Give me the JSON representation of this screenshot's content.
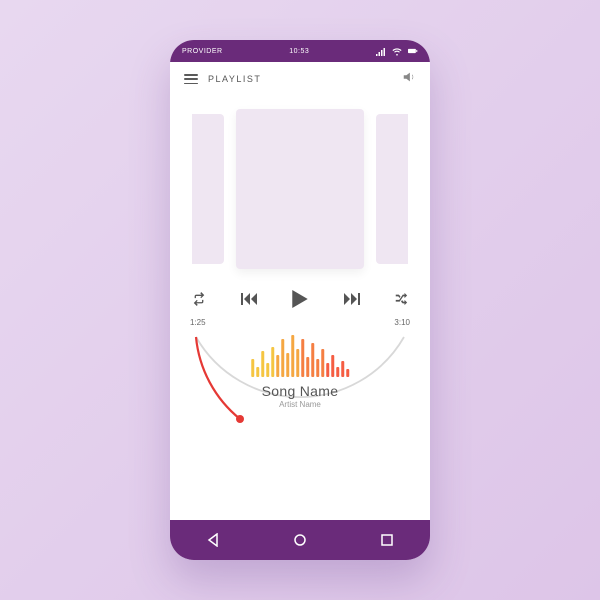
{
  "statusbar": {
    "provider": "PROVIDER",
    "time": "10:53"
  },
  "header": {
    "title": "PLAYLIST"
  },
  "progress": {
    "elapsed": "1:25",
    "total": "3:10"
  },
  "song": {
    "name": "Song Name",
    "artist": "Artist Name"
  },
  "colors": {
    "accent": "#6a2b7a",
    "progress": "#e53935"
  },
  "eq_heights": [
    18,
    10,
    26,
    14,
    30,
    22,
    38,
    24,
    42,
    28,
    38,
    20,
    34,
    18,
    28,
    14,
    22,
    10,
    16,
    8
  ],
  "eq_gradient": [
    "#f5c542",
    "#f5a742",
    "#f57f42",
    "#f55d42"
  ]
}
